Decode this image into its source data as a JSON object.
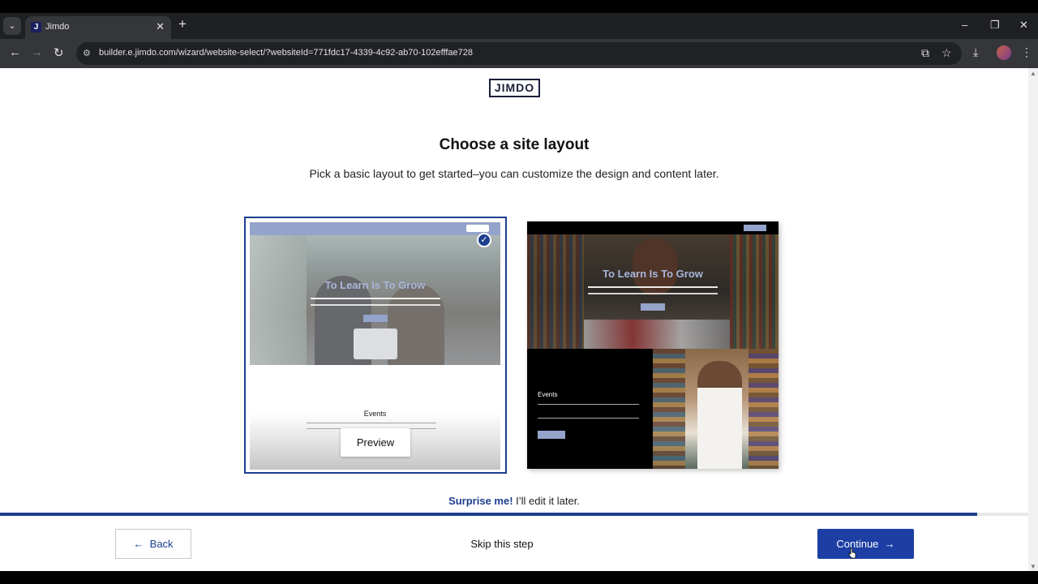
{
  "browser": {
    "tab_title": "Jimdo",
    "favicon_letter": "J",
    "tab_close": "✕",
    "new_tab": "+",
    "tab_dropdown": "⌄",
    "url": "builder.e.jimdo.com/wizard/website-select/?websiteId=771fdc17-4339-4c92-ab70-102efffae728",
    "window_controls": {
      "minimize": "–",
      "restore": "❐",
      "close": "✕"
    },
    "nav": {
      "back": "←",
      "forward": "→",
      "reload": "↻"
    },
    "icons": {
      "site_info": "⚙",
      "install": "⧉",
      "bookmark": "☆",
      "download": "⤓",
      "menu": "⋮"
    }
  },
  "page": {
    "logo": "JIMDO",
    "headline": "Choose a site layout",
    "subtext": "Pick a basic layout to get started–you can customize the design and content later.",
    "layouts": [
      {
        "hero_title": "To Learn Is To Grow",
        "events_title": "Events",
        "preview_label": "Preview",
        "checkmark": "✓",
        "selected": true
      },
      {
        "hero_title": "To Learn Is To Grow",
        "events_title": "Events",
        "selected": false
      }
    ],
    "surprise": {
      "link": "Surprise me!",
      "text": " I’ll edit it later."
    }
  },
  "footer": {
    "progress": 0.95,
    "back_label": "Back",
    "back_arrow": "←",
    "skip_label": "Skip this step",
    "continue_label": "Continue",
    "continue_arrow": "→"
  },
  "colors": {
    "accent": "#1d3f8f",
    "continue_bg": "#1d3fa5",
    "preview_nav": "#94a3c9"
  }
}
